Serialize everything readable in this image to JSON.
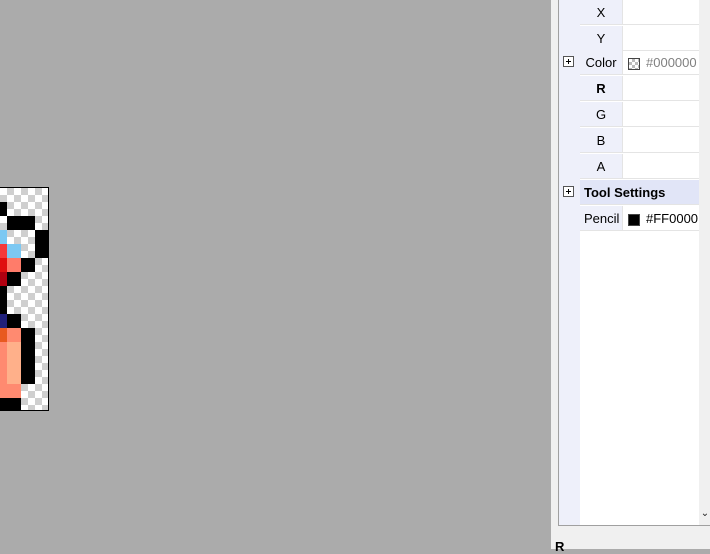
{
  "properties": {
    "rows": [
      {
        "label": "X",
        "value": ""
      },
      {
        "label": "Y",
        "value": ""
      },
      {
        "label": "Color",
        "value": "#000000"
      },
      {
        "label": "R",
        "value": ""
      },
      {
        "label": "G",
        "value": ""
      },
      {
        "label": "B",
        "value": ""
      },
      {
        "label": "A",
        "value": ""
      }
    ],
    "group_tool": "Tool Settings",
    "tool_row": {
      "label": "Pencil",
      "value": "#FF0000"
    }
  },
  "description_title": "R",
  "colors": {
    "swatch_color": "#000000",
    "pencil_swatch": "#000000",
    "canvas_bg": "#ababab",
    "grid_gutter": "#eef0fa"
  }
}
